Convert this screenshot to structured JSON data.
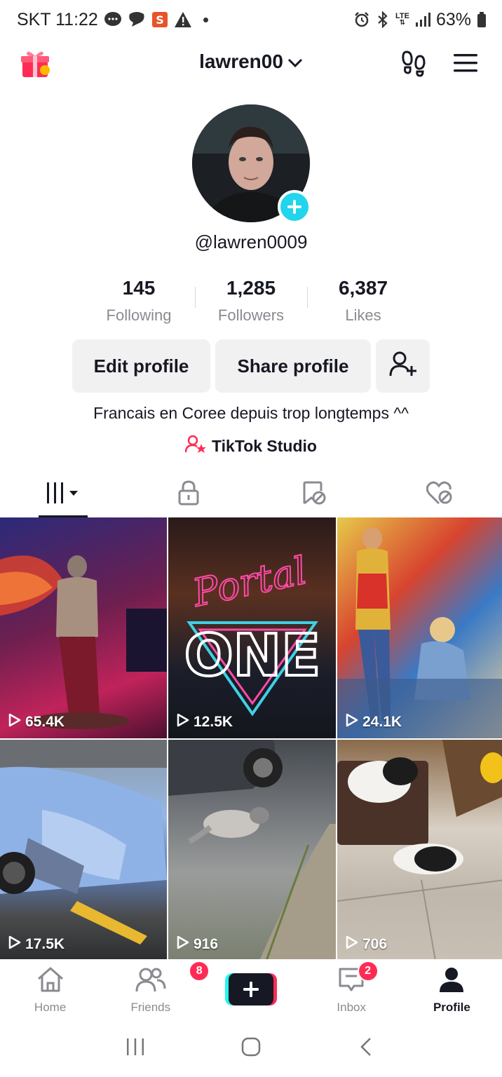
{
  "status": {
    "carrier_time": "SKT 11:22",
    "battery": "63%",
    "net": "LTE"
  },
  "header": {
    "username": "lawren00"
  },
  "profile": {
    "handle": "@lawren0009",
    "stats": [
      {
        "num": "145",
        "label": "Following"
      },
      {
        "num": "1,285",
        "label": "Followers"
      },
      {
        "num": "6,387",
        "label": "Likes"
      }
    ],
    "buttons": {
      "edit": "Edit profile",
      "share": "Share profile"
    },
    "bio": "Francais en Coree depuis trop longtemps ^^",
    "studio": "TikTok Studio"
  },
  "videos": [
    {
      "views": "65.4K"
    },
    {
      "views": "12.5K"
    },
    {
      "views": "24.1K"
    },
    {
      "views": "17.5K"
    },
    {
      "views": "916"
    },
    {
      "views": "706"
    }
  ],
  "thumb_text": {
    "neon_script": "Portal",
    "neon_block": "ONE"
  },
  "nav": {
    "home": "Home",
    "friends": "Friends",
    "friends_badge": "8",
    "inbox": "Inbox",
    "inbox_badge": "2",
    "profile": "Profile"
  },
  "colors": {
    "accent_cyan": "#20d5ec",
    "accent_red": "#fe2c55",
    "text": "#161823",
    "muted": "#8a8b91"
  }
}
